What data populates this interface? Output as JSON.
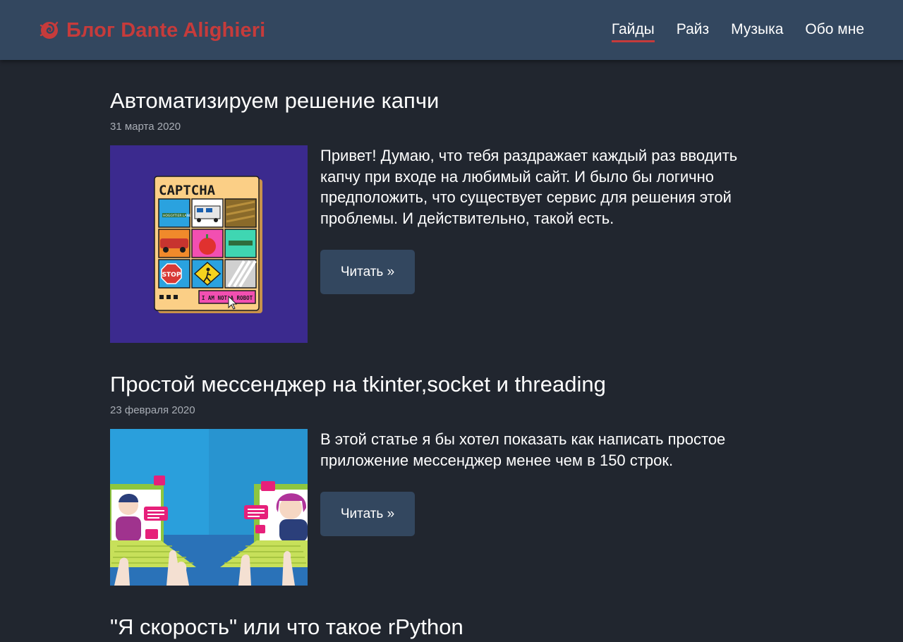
{
  "site": {
    "title": "Блог Dante Alighieri",
    "logo_icon": "spiral-logo-icon"
  },
  "nav": {
    "items": [
      {
        "label": "Гайды",
        "active": true
      },
      {
        "label": "Райз",
        "active": false
      },
      {
        "label": "Музыка",
        "active": false
      },
      {
        "label": "Обо мне",
        "active": false
      }
    ]
  },
  "posts": [
    {
      "title": "Автоматизируем решение капчи",
      "date": "31 марта 2020",
      "excerpt": "Привет! Думаю, что тебя раздражает каждый раз вводить капчу при входе на любимый сайт. И было бы логично предположить, что существует сервис для решения этой проблемы. И действительно, такой есть.",
      "read_label": "Читать »",
      "image": {
        "heading": "CAPTCHA",
        "street_sign": "HOGGYTIER LANE",
        "stop_sign": "STOP",
        "button": "I AM NOT A ROBOT"
      }
    },
    {
      "title": "Простой мессенджер на tkinter,socket и threading",
      "date": "23 февраля 2020",
      "excerpt": "В этой статье я бы хотел показать как написать простое приложение мессенджер менее чем в 150 строк.",
      "read_label": "Читать »"
    },
    {
      "title": "\"Я скорость\" или что такое rPython"
    }
  ],
  "colors": {
    "background": "#21262f",
    "header": "#33475f",
    "accent": "#c63b3b",
    "button": "#33475f",
    "date_text": "#a8adb5"
  }
}
